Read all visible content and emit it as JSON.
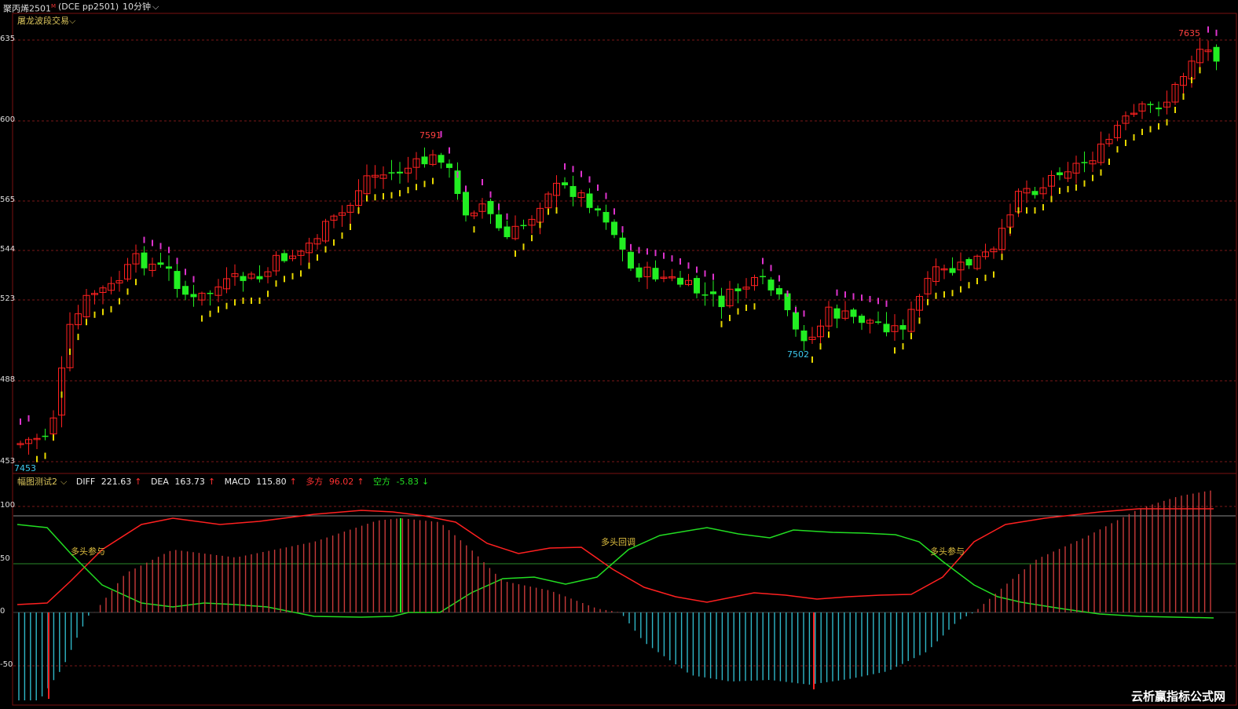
{
  "topbar": {
    "title": "聚丙烯2501",
    "title_sup": "M",
    "symbol": "(DCE  pp2501)",
    "period": "10分钟",
    "period_icon": "chevron-down-icon"
  },
  "main_panel": {
    "indicator_name": "屠龙波段交易",
    "indicator_icon": "chevron-down-icon",
    "y_axis_labels": [
      "635",
      "600",
      "565",
      "544",
      "523",
      "488",
      "453"
    ],
    "annotations": {
      "high_1": "7591",
      "low_1": "7502",
      "high_2": "7635",
      "start_low": "7453"
    },
    "colors": {
      "up": "#ff2020",
      "down": "#22ee22",
      "trail_up": "#e8d800",
      "trail_down": "#dd33cc"
    }
  },
  "sub_panel": {
    "indicator_name": "幅图测试2",
    "indicator_icon": "chevron-down-icon",
    "readouts": {
      "diff_label": "DIFF",
      "diff_value": "221.63",
      "dea_label": "DEA",
      "dea_value": "163.73",
      "macd_label": "MACD",
      "macd_value": "115.80",
      "long_label": "多方",
      "long_value": "96.02",
      "short_label": "空方",
      "short_value": "-5.83",
      "up_arrow": "↑",
      "down_arrow": "↓"
    },
    "y_axis_labels": [
      "100",
      "50",
      "0",
      "-50"
    ],
    "signals": [
      "多头参与",
      "多头回调",
      "多头参与"
    ],
    "colors": {
      "red_line": "#ff2020",
      "green_line": "#22dd22",
      "pos_bar": "#c83a3a",
      "neg_bar": "#2fb7c7",
      "signal_text": "#e0c040"
    }
  },
  "watermark": "云析赢指标公式网"
}
